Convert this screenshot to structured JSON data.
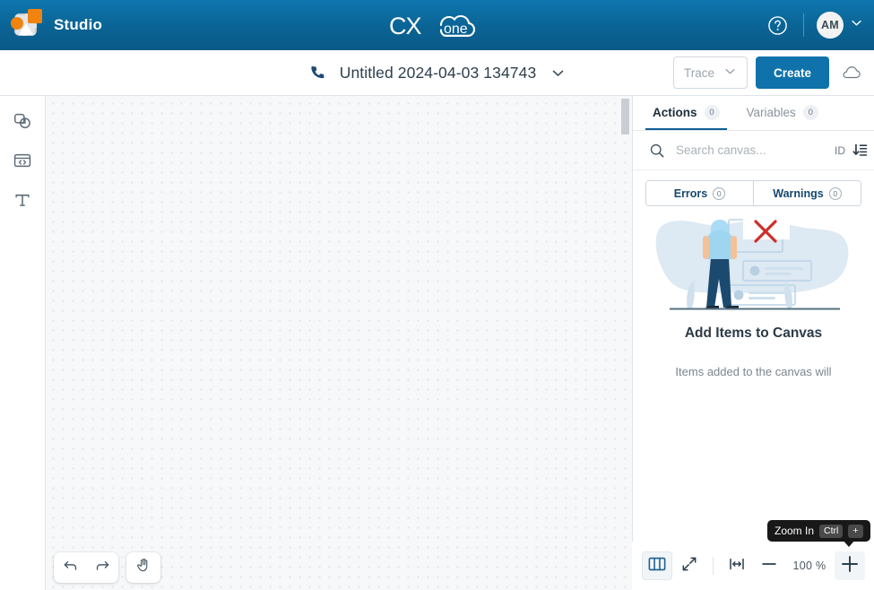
{
  "topbar": {
    "brand_name": "Studio",
    "brand_icon": "studio-app-icon",
    "logo_cx": "CX",
    "logo_one": "one",
    "help_icon": "question-circle-icon",
    "avatar_initials": "AM",
    "avatar_chevron_icon": "chevron-down-icon"
  },
  "subbar": {
    "phone_icon": "phone-icon",
    "flow_title": "Untitled 2024-04-03 134743",
    "title_chevron_icon": "chevron-down-icon",
    "trace_label": "Trace",
    "trace_chevron_icon": "chevron-down-icon",
    "create_label": "Create",
    "cloud_icon": "cloud-icon"
  },
  "rail": {
    "items": [
      {
        "name": "sidebar-item-shapes",
        "icon": "shapes-icon"
      },
      {
        "name": "sidebar-item-snippet",
        "icon": "code-window-icon"
      },
      {
        "name": "sidebar-item-text",
        "icon": "text-t-icon",
        "glyph": "T"
      }
    ]
  },
  "canvas": {
    "undo_icon": "undo-icon",
    "redo_icon": "redo-icon",
    "pan_icon": "hand-pan-icon",
    "scrollbar": "vertical-scrollbar"
  },
  "panel": {
    "tabs": [
      {
        "label": "Actions",
        "count": "0",
        "active": true
      },
      {
        "label": "Variables",
        "count": "0",
        "active": false
      }
    ],
    "search": {
      "icon": "search-icon",
      "placeholder": "Search canvas...",
      "value": "",
      "sort_label": "ID",
      "sort_icon": "sort-descending-icon"
    },
    "segmented": [
      {
        "label": "Errors",
        "count": "0"
      },
      {
        "label": "Warnings",
        "count": "0"
      }
    ],
    "empty_state": {
      "illustration": "person-empty-canvas-illustration",
      "title": "Add Items to Canvas",
      "subtitle": "Items added to the canvas will"
    }
  },
  "bottombar": {
    "minimap_icon": "minimap-book-icon",
    "fullscreen_icon": "expand-diagonal-icon",
    "fit_width_icon": "fit-to-width-icon",
    "zoom_out_icon": "minus-icon",
    "zoom_level": "100 %",
    "zoom_in_icon": "plus-icon",
    "tooltip": {
      "text": "Zoom In",
      "key_modifier": "Ctrl",
      "key_main": "+"
    }
  },
  "colors": {
    "brand_blue": "#0a6394",
    "accent_blue": "#0f72ab",
    "orange": "#f0840f",
    "error_red": "#d0342c",
    "canvas_bg": "#f7f8f9"
  }
}
